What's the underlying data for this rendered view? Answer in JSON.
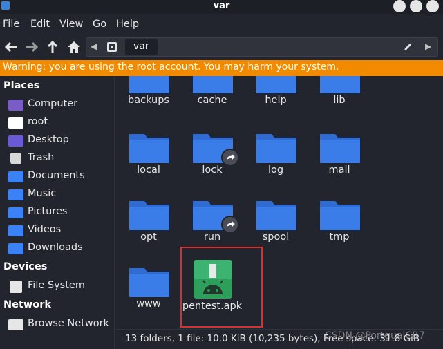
{
  "window": {
    "title": "var"
  },
  "menu": [
    "File",
    "Edit",
    "View",
    "Go",
    "Help"
  ],
  "path": {
    "current": "var"
  },
  "warning": "Warning: you are using the root account. You may harm your system.",
  "sidebar": {
    "places_header": "Places",
    "places": [
      {
        "label": "Computer",
        "icon": "computer-icon",
        "color": "#7a5cc7"
      },
      {
        "label": "root",
        "icon": "home-folder-icon",
        "color": "#ffffff"
      },
      {
        "label": "Desktop",
        "icon": "desktop-icon",
        "color": "#6a5ad6"
      },
      {
        "label": "Trash",
        "icon": "trash-icon",
        "color": "#d8d8d8"
      },
      {
        "label": "Documents",
        "icon": "documents-icon",
        "color": "#3b82f6"
      },
      {
        "label": "Music",
        "icon": "music-icon",
        "color": "#3b82f6"
      },
      {
        "label": "Pictures",
        "icon": "pictures-icon",
        "color": "#3b82f6"
      },
      {
        "label": "Videos",
        "icon": "videos-icon",
        "color": "#3b82f6"
      },
      {
        "label": "Downloads",
        "icon": "downloads-icon",
        "color": "#3b82f6"
      }
    ],
    "devices_header": "Devices",
    "devices": [
      {
        "label": "File System",
        "icon": "drive-icon",
        "color": "#e6e6e6"
      }
    ],
    "network_header": "Network",
    "network": [
      {
        "label": "Browse Network",
        "icon": "network-icon",
        "color": "#e6e6e6"
      }
    ]
  },
  "files": [
    {
      "name": "backups",
      "type": "folder"
    },
    {
      "name": "cache",
      "type": "folder"
    },
    {
      "name": "help",
      "type": "folder"
    },
    {
      "name": "lib",
      "type": "folder"
    },
    {
      "name": "local",
      "type": "folder"
    },
    {
      "name": "lock",
      "type": "folder",
      "symlink": true
    },
    {
      "name": "log",
      "type": "folder"
    },
    {
      "name": "mail",
      "type": "folder"
    },
    {
      "name": "opt",
      "type": "folder"
    },
    {
      "name": "run",
      "type": "folder",
      "symlink": true
    },
    {
      "name": "spool",
      "type": "folder"
    },
    {
      "name": "tmp",
      "type": "folder"
    },
    {
      "name": "www",
      "type": "folder"
    },
    {
      "name": "pentest.apk",
      "type": "apk"
    }
  ],
  "status": "13 folders, 1 file: 10.0 KiB (10,235 bytes), Free space: 31.8 GiB",
  "watermark": "CSDN @PortgualCR7",
  "colors": {
    "folder": "#3b7de8",
    "folder_tab": "#2f6bd0",
    "warning": "#f28a00",
    "selection": "#d83030",
    "apk": "#2e9e5b"
  }
}
